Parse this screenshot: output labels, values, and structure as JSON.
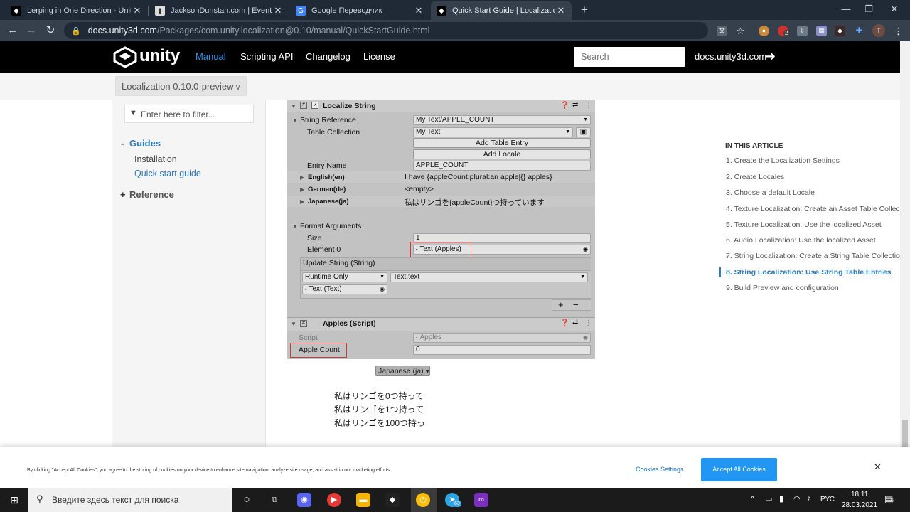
{
  "browser": {
    "tabs": [
      {
        "title": "Lerping in One Direction - Unity",
        "active": false
      },
      {
        "title": "JacksonDunstan.com | Event Perf",
        "active": false
      },
      {
        "title": "Google Переводчик",
        "active": false
      },
      {
        "title": "Quick Start Guide | Localization |",
        "active": true
      }
    ],
    "url_host": "docs.unity3d.com",
    "url_path": "/Packages/com.unity.localization@0.10/manual/QuickStartGuide.html",
    "extension_badge": "2",
    "profile_initial": "T"
  },
  "header": {
    "logo_text": "unity",
    "nav": [
      "Manual",
      "Scripting API",
      "Changelog",
      "License"
    ],
    "search_placeholder": "Search",
    "docs_link": "docs.unity3d.com",
    "accent": "#2196f3"
  },
  "version": {
    "label": "Localization 0.10.0-preview",
    "chevron": "v"
  },
  "sidebar": {
    "filter_placeholder": "Enter here to filter...",
    "guides_toggle": "-",
    "guides_label": "Guides",
    "items": [
      "Installation",
      "Quick start guide"
    ],
    "reference_toggle": "+",
    "reference_label": "Reference"
  },
  "inspector": {
    "component_title": "Localize String",
    "string_reference_label": "String Reference",
    "string_reference_value": "My Text/APPLE_COUNT",
    "table_collection_label": "Table Collection",
    "table_collection_value": "My Text",
    "add_table_entry": "Add Table Entry",
    "add_locale": "Add Locale",
    "entry_name_label": "Entry Name",
    "entry_name_value": "APPLE_COUNT",
    "locales": [
      {
        "name": "English(en)",
        "value": "I have {appleCount:plural:an apple|{} apples}"
      },
      {
        "name": "German(de)",
        "value": "<empty>"
      },
      {
        "name": "Japanese(ja)",
        "value": "私はリンゴを{appleCount}つ持っています"
      }
    ],
    "format_arguments_label": "Format Arguments",
    "size_label": "Size",
    "size_value": "1",
    "element0_label": "Element 0",
    "element0_value": "Text (Apples)",
    "update_string_label": "Update String (String)",
    "runtime_only": "Runtime Only",
    "text_text": "Text.text",
    "text_text_obj": "Text (Text)",
    "plus": "+",
    "minus": "−",
    "script_component_title": "Apples (Script)",
    "script_label": "Script",
    "script_value": "Apples",
    "apple_count_label": "Apple Count",
    "apple_count_value": "0"
  },
  "preview": {
    "dropdown": "Japanese (ja)",
    "lines": [
      "私はリンゴを0つ持って",
      "私はリンゴを1つ持って",
      "私はリンゴを100つ持っ"
    ]
  },
  "toc": {
    "title": "IN THIS ARTICLE",
    "items": [
      "1. Create the Localization Settings",
      "2. Create Locales",
      "3. Choose a default Locale",
      "4. Texture Localization: Create an Asset Table Collectic",
      "5. Texture Localization: Use the localized Asset",
      "6. Audio Localization: Use the localized Asset",
      "7. String Localization: Create a String Table Collection",
      "8. String Localization: Use String Table Entries",
      "9. Build Preview and configuration"
    ],
    "active_index": 7
  },
  "cookie": {
    "text": "By clicking \"Accept All Cookies\", you agree to the storing of cookies on your device to enhance site navigation, analyze site usage, and assist in our marketing efforts.",
    "settings": "Cookies Settings",
    "accept": "Accept All Cookies",
    "close": "✕"
  },
  "taskbar": {
    "search_placeholder": "Введите здесь текст для поиска",
    "language": "РУС",
    "time": "18:11",
    "date": "28.03.2021",
    "telegram_badge": "63",
    "notification_count": "5"
  }
}
